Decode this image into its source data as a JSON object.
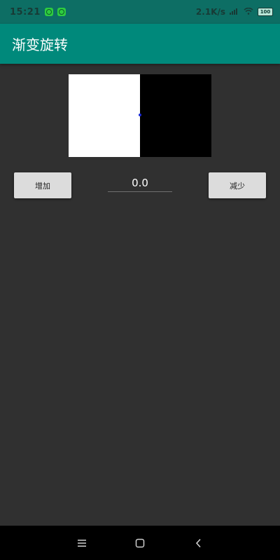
{
  "status_bar": {
    "time": "15:21",
    "speed": "2.1K/s",
    "battery": "100"
  },
  "app_bar": {
    "title": "渐变旋转"
  },
  "controls": {
    "increase_label": "增加",
    "value": "0.0",
    "decrease_label": "减少"
  },
  "nav_bar": {
    "menu_icon": "menu-icon",
    "home_icon": "home-icon",
    "back_icon": "back-icon"
  },
  "colors": {
    "status_bar": "#0d6e64",
    "app_bar": "#00897b",
    "background": "#303030",
    "button": "#dcdcdc",
    "center_dot": "#1a2bd6"
  }
}
